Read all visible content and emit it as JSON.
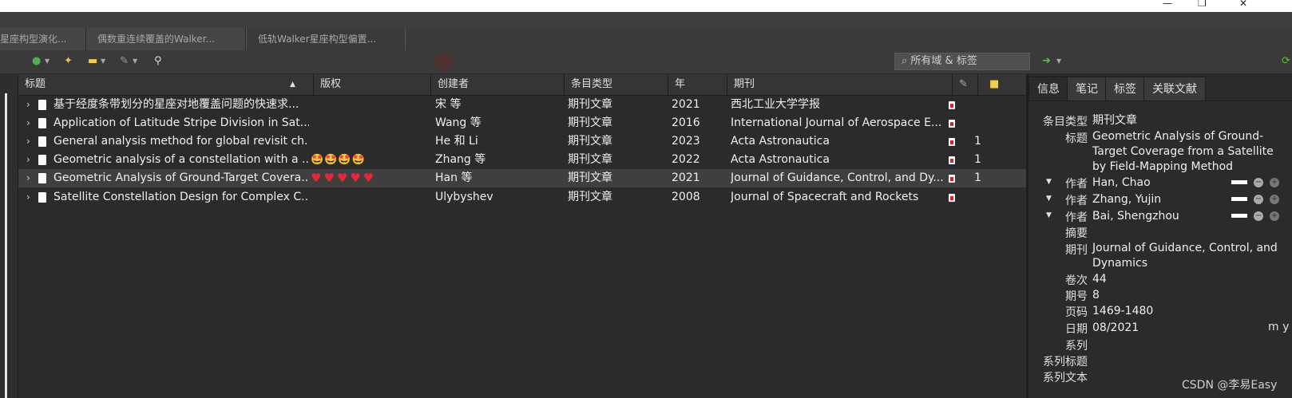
{
  "window": {
    "restore_glyph": "❐",
    "close_glyph": "✕",
    "minimize_glyph": "—"
  },
  "tabs": [
    {
      "label": "星座构型演化..."
    },
    {
      "label": "偶数重连续覆盖的Walker..."
    },
    {
      "label": "低轨Walker星座构型偏置..."
    }
  ],
  "toolbar": {
    "search_placeholder": "所有域 & 标签",
    "search_icon": "magnifier-icon",
    "new_item_icon": "plus-circle-icon",
    "wand_icon": "magic-wand-icon",
    "note_icon": "note-icon",
    "attach_icon": "paperclip-icon",
    "find_icon": "search-icon",
    "sync_icon": "sync-icon",
    "locate_icon": "arrow-right-icon"
  },
  "columns": {
    "title": "标题",
    "rights": "版权",
    "creator": "创建者",
    "item_type": "条目类型",
    "year": "年",
    "publication": "期刊"
  },
  "rows": [
    {
      "title": "基于经度条带划分的星座对地覆盖问题的快速求...",
      "rights": "",
      "creator": "宋 等",
      "type": "期刊文章",
      "year": "2021",
      "pub": "西北工业大学学报",
      "notes": ""
    },
    {
      "title": "Application of Latitude Stripe Division in Sat...",
      "rights": "",
      "creator": "Wang 等",
      "type": "期刊文章",
      "year": "2016",
      "pub": "International Journal of Aerospace E...",
      "notes": ""
    },
    {
      "title": "General analysis method for global revisit ch...",
      "rights": "",
      "creator": "He 和 Li",
      "type": "期刊文章",
      "year": "2023",
      "pub": "Acta Astronautica",
      "notes": "1"
    },
    {
      "title": "Geometric analysis of a constellation with a ...",
      "rights": "🤩🤩🤩🤩",
      "creator": "Zhang 等",
      "type": "期刊文章",
      "year": "2022",
      "pub": "Acta Astronautica",
      "notes": "1"
    },
    {
      "title": "Geometric Analysis of Ground-Target Covera...",
      "rights": "♥♥♥♥♥",
      "creator": "Han 等",
      "type": "期刊文章",
      "year": "2021",
      "pub": "Journal of Guidance, Control, and Dy...",
      "notes": "1"
    },
    {
      "title": "Satellite Constellation Design for Complex C...",
      "rights": "",
      "creator": "Ulybyshev",
      "type": "期刊文章",
      "year": "2008",
      "pub": "Journal of Spacecraft and Rockets",
      "notes": ""
    }
  ],
  "right_tabs": [
    "信息",
    "笔记",
    "标签",
    "关联文献"
  ],
  "info": {
    "item_type_label": "条目类型",
    "item_type": "期刊文章",
    "title_label": "标题",
    "title": "Geometric Analysis of Ground-Target Coverage from a Satellite by Field-Mapping Method",
    "author_label": "作者",
    "authors": [
      "Han, Chao",
      "Zhang, Yujin",
      "Bai, Shengzhou"
    ],
    "abstract_label": "摘要",
    "publication_label": "期刊",
    "publication": "Journal of Guidance, Control, and Dynamics",
    "volume_label": "卷次",
    "volume": "44",
    "issue_label": "期号",
    "issue": "8",
    "pages_label": "页码",
    "pages": "1469-1480",
    "date_label": "日期",
    "date": "08/2021",
    "date_hint": "m y",
    "series_label": "系列",
    "series_title_label": "系列标题",
    "series_text_label": "系列文本"
  },
  "watermark": "CSDN @李易Easy"
}
